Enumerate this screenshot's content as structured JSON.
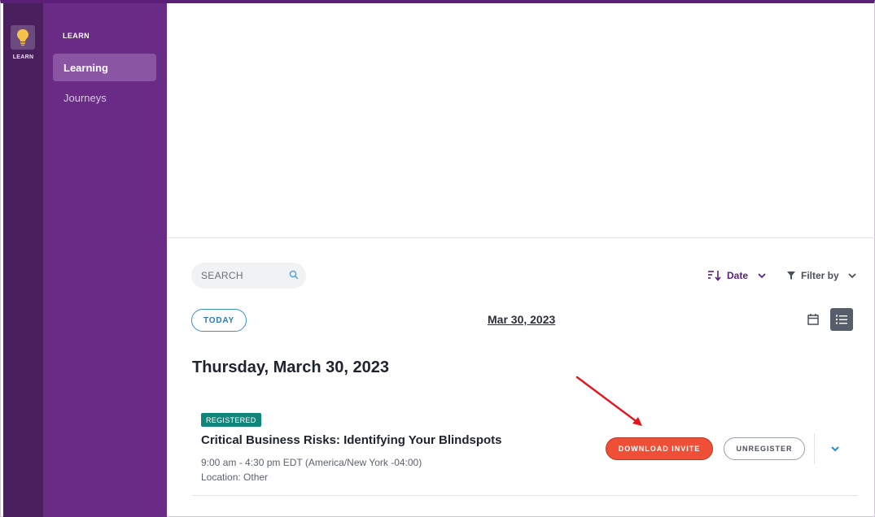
{
  "rail": {
    "app_label": "LEARN",
    "app_icon": "lightbulb-icon"
  },
  "nav": {
    "heading": "LEARN",
    "items": [
      {
        "label": "Learning",
        "active": true
      },
      {
        "label": "Journeys",
        "active": false
      }
    ]
  },
  "toolbar": {
    "search_placeholder": "SEARCH",
    "sort_label": "Date",
    "filter_label": "Filter by"
  },
  "calendar": {
    "today_label": "TODAY",
    "current_date": "Mar 30, 2023"
  },
  "day_heading": "Thursday, March 30, 2023",
  "event": {
    "status": "REGISTERED",
    "title": "Critical Business Risks: Identifying Your Blindspots",
    "time": "9:00 am - 4:30 pm EDT (America/New York -04:00)",
    "location": "Location: Other",
    "download_label": "DOWNLOAD INVITE",
    "unregister_label": "UNREGISTER"
  },
  "colors": {
    "rail_bg": "#4a1f5e",
    "nav_bg": "#6a2b86",
    "accent_purple": "#5b1f7a",
    "registered_badge": "#12857a",
    "download_button": "#ee4f36",
    "annotation_arrow": "#e8141b"
  }
}
